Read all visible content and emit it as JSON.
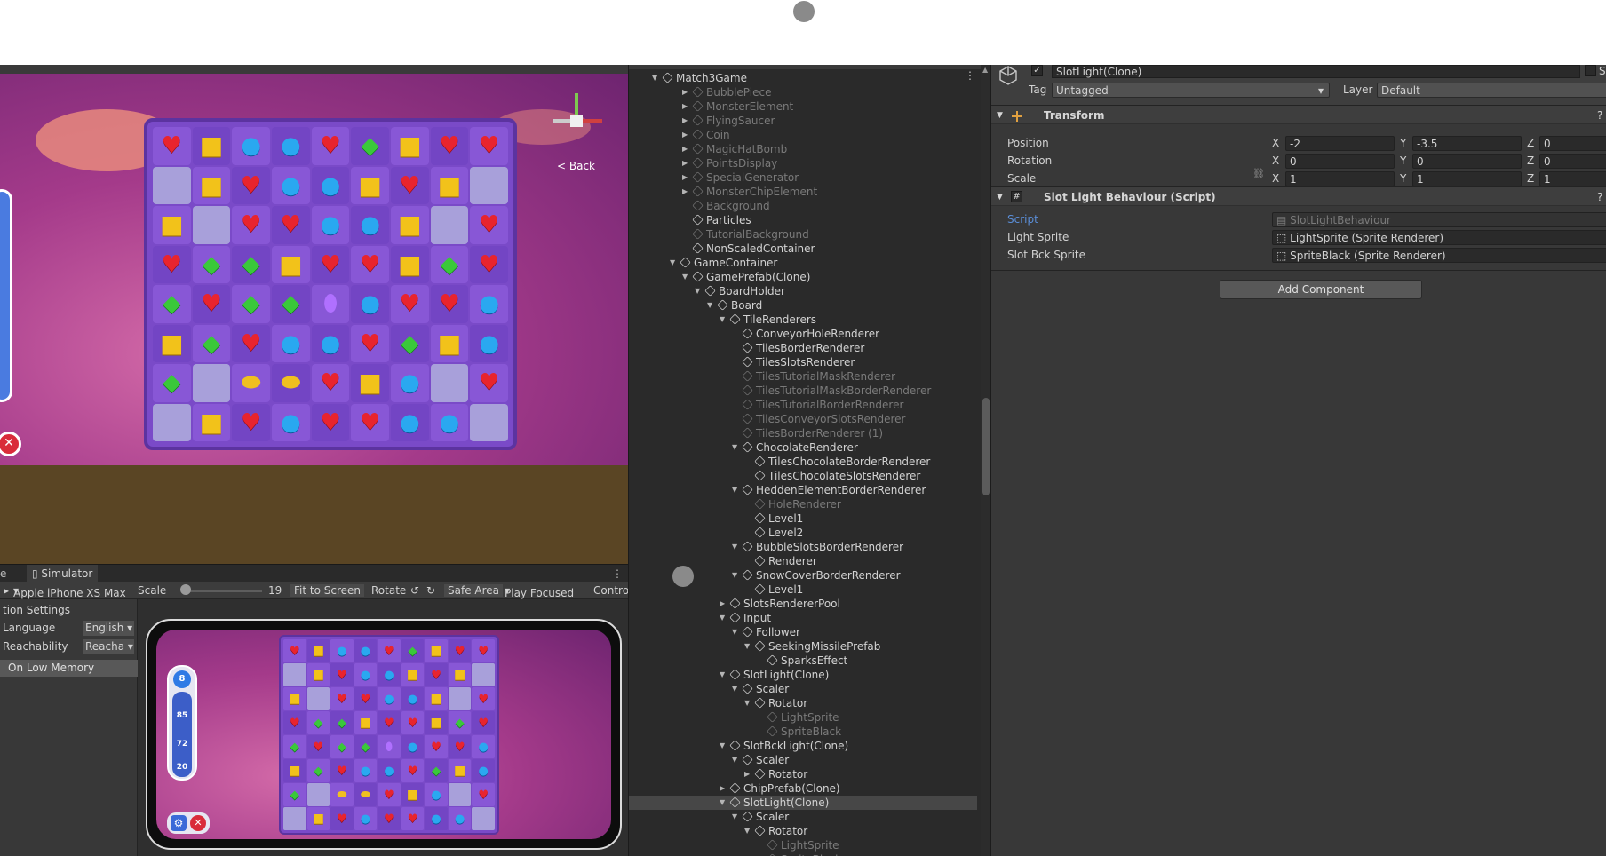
{
  "scene": {
    "back_label": "< Back",
    "board_rows": [
      [
        "heart",
        "square",
        "blue",
        "blue",
        "heart",
        "green",
        "square",
        "heart",
        "heart"
      ],
      [
        "empty",
        "square",
        "heart",
        "blue",
        "blue",
        "square",
        "heart",
        "square",
        "empty"
      ],
      [
        "square",
        "empty",
        "heart",
        "heart",
        "blue",
        "blue",
        "square",
        "empty",
        "heart"
      ],
      [
        "heart",
        "green",
        "green",
        "square",
        "heart",
        "heart",
        "square",
        "green",
        "heart"
      ],
      [
        "green",
        "heart",
        "green",
        "green",
        "jar",
        "blue",
        "heart",
        "heart",
        "blue"
      ],
      [
        "square",
        "green",
        "heart",
        "blue",
        "blue",
        "heart",
        "green",
        "square",
        "blue"
      ],
      [
        "green",
        "empty",
        "bomb",
        "bomb",
        "heart",
        "square",
        "blue",
        "empty",
        "heart"
      ],
      [
        "empty",
        "square",
        "heart",
        "blue",
        "heart",
        "heart",
        "blue",
        "blue",
        "empty"
      ]
    ]
  },
  "simulator": {
    "left_tab_fragment": "e",
    "tab_label": "Simulator",
    "device": "Apple iPhone XS Max",
    "scale_label": "Scale",
    "scale_value": "19",
    "fit_label": "Fit to Screen",
    "rotate_label": "Rotate",
    "safe_area_label": "Safe Area",
    "play_focused_label": "Play Focused",
    "control_label": "Contro",
    "settings_title": "tion Settings",
    "language_label": "Language",
    "language_value": "English",
    "reachability_label": "Reachability",
    "reachability_value": "Reacha",
    "low_memory_label": "On Low Memory",
    "hud": {
      "moves": "8",
      "count1": "85",
      "count2": "72",
      "count3": "20"
    }
  },
  "hierarchy": {
    "rows": [
      {
        "name": "Match3Game",
        "depth": 0,
        "arrow": "down",
        "dim": false,
        "root": true
      },
      {
        "name": "BubblePiece",
        "depth": 3,
        "arrow": "right",
        "dim": true
      },
      {
        "name": "MonsterElement",
        "depth": 3,
        "arrow": "right",
        "dim": true
      },
      {
        "name": "FlyingSaucer",
        "depth": 3,
        "arrow": "right",
        "dim": true
      },
      {
        "name": "Coin",
        "depth": 3,
        "arrow": "right",
        "dim": true
      },
      {
        "name": "MagicHatBomb",
        "depth": 3,
        "arrow": "right",
        "dim": true
      },
      {
        "name": "PointsDisplay",
        "depth": 3,
        "arrow": "right",
        "dim": true
      },
      {
        "name": "SpecialGenerator",
        "depth": 3,
        "arrow": "right",
        "dim": true
      },
      {
        "name": "MonsterChipElement",
        "depth": 3,
        "arrow": "right",
        "dim": true
      },
      {
        "name": "Background",
        "depth": 3,
        "arrow": "",
        "dim": true
      },
      {
        "name": "Particles",
        "depth": 3,
        "arrow": "",
        "dim": false
      },
      {
        "name": "TutorialBackground",
        "depth": 3,
        "arrow": "",
        "dim": true
      },
      {
        "name": "NonScaledContainer",
        "depth": 3,
        "arrow": "",
        "dim": false
      },
      {
        "name": "GameContainer",
        "depth": 2,
        "arrow": "down",
        "dim": false
      },
      {
        "name": "GamePrefab(Clone)",
        "depth": 3,
        "arrow": "down",
        "dim": false
      },
      {
        "name": "BoardHolder",
        "depth": 4,
        "arrow": "down",
        "dim": false
      },
      {
        "name": "Board",
        "depth": 5,
        "arrow": "down",
        "dim": false
      },
      {
        "name": "TileRenderers",
        "depth": 6,
        "arrow": "down",
        "dim": false
      },
      {
        "name": "ConveyorHoleRenderer",
        "depth": 7,
        "arrow": "",
        "dim": false
      },
      {
        "name": "TilesBorderRenderer",
        "depth": 7,
        "arrow": "",
        "dim": false
      },
      {
        "name": "TilesSlotsRenderer",
        "depth": 7,
        "arrow": "",
        "dim": false
      },
      {
        "name": "TilesTutorialMaskRenderer",
        "depth": 7,
        "arrow": "",
        "dim": true
      },
      {
        "name": "TilesTutorialMaskBorderRenderer",
        "depth": 7,
        "arrow": "",
        "dim": true
      },
      {
        "name": "TilesTutorialBorderRenderer",
        "depth": 7,
        "arrow": "",
        "dim": true
      },
      {
        "name": "TilesConveyorSlotsRenderer",
        "depth": 7,
        "arrow": "",
        "dim": true
      },
      {
        "name": "TilesBorderRenderer (1)",
        "depth": 7,
        "arrow": "",
        "dim": true
      },
      {
        "name": "ChocolateRenderer",
        "depth": 7,
        "arrow": "down",
        "dim": false
      },
      {
        "name": "TilesChocolateBorderRenderer",
        "depth": 8,
        "arrow": "",
        "dim": false
      },
      {
        "name": "TilesChocolateSlotsRenderer",
        "depth": 8,
        "arrow": "",
        "dim": false
      },
      {
        "name": "HeddenElementBorderRenderer",
        "depth": 7,
        "arrow": "down",
        "dim": false
      },
      {
        "name": "HoleRenderer",
        "depth": 8,
        "arrow": "",
        "dim": true
      },
      {
        "name": "Level1",
        "depth": 8,
        "arrow": "",
        "dim": false
      },
      {
        "name": "Level2",
        "depth": 8,
        "arrow": "",
        "dim": false
      },
      {
        "name": "BubbleSlotsBorderRenderer",
        "depth": 7,
        "arrow": "down",
        "dim": false
      },
      {
        "name": "Renderer",
        "depth": 8,
        "arrow": "",
        "dim": false
      },
      {
        "name": "SnowCoverBorderRenderer",
        "depth": 7,
        "arrow": "down",
        "dim": false
      },
      {
        "name": "Level1",
        "depth": 8,
        "arrow": "",
        "dim": false
      },
      {
        "name": "SlotsRendererPool",
        "depth": 6,
        "arrow": "right",
        "dim": false
      },
      {
        "name": "Input",
        "depth": 6,
        "arrow": "down",
        "dim": false
      },
      {
        "name": "Follower",
        "depth": 7,
        "arrow": "down",
        "dim": false
      },
      {
        "name": "SeekingMissilePrefab",
        "depth": 8,
        "arrow": "down",
        "dim": false
      },
      {
        "name": "SparksEffect",
        "depth": 9,
        "arrow": "",
        "dim": false
      },
      {
        "name": "SlotLight(Clone)",
        "depth": 6,
        "arrow": "down",
        "dim": false
      },
      {
        "name": "Scaler",
        "depth": 7,
        "arrow": "down",
        "dim": false
      },
      {
        "name": "Rotator",
        "depth": 8,
        "arrow": "down",
        "dim": false
      },
      {
        "name": "LightSprite",
        "depth": 9,
        "arrow": "",
        "dim": true
      },
      {
        "name": "SpriteBlack",
        "depth": 9,
        "arrow": "",
        "dim": true
      },
      {
        "name": "SlotBckLight(Clone)",
        "depth": 6,
        "arrow": "down",
        "dim": false
      },
      {
        "name": "Scaler",
        "depth": 7,
        "arrow": "down",
        "dim": false
      },
      {
        "name": "Rotator",
        "depth": 8,
        "arrow": "right",
        "dim": false
      },
      {
        "name": "ChipPrefab(Clone)",
        "depth": 6,
        "arrow": "right",
        "dim": false
      },
      {
        "name": "SlotLight(Clone)",
        "depth": 6,
        "arrow": "down",
        "dim": false,
        "selected": true
      },
      {
        "name": "Scaler",
        "depth": 7,
        "arrow": "down",
        "dim": false
      },
      {
        "name": "Rotator",
        "depth": 8,
        "arrow": "down",
        "dim": false
      },
      {
        "name": "LightSprite",
        "depth": 9,
        "arrow": "",
        "dim": true
      },
      {
        "name": "SpriteBlack",
        "depth": 9,
        "arrow": "",
        "dim": true
      }
    ]
  },
  "inspector": {
    "object_name": "SlotLight(Clone)",
    "static_fragment": "S",
    "tag_label": "Tag",
    "tag_value": "Untagged",
    "layer_label": "Layer",
    "layer_value": "Default",
    "transform": {
      "title": "Transform",
      "position_label": "Position",
      "rotation_label": "Rotation",
      "scale_label": "Scale",
      "axis_x": "X",
      "axis_y": "Y",
      "axis_z": "Z",
      "position": {
        "x": "-2",
        "y": "-3.5",
        "z": "0"
      },
      "rotation": {
        "x": "0",
        "y": "0",
        "z": "0"
      },
      "scale": {
        "x": "1",
        "y": "1",
        "z": "1"
      }
    },
    "script_component": {
      "title": "Slot Light Behaviour (Script)",
      "script_label": "Script",
      "script_value": "SlotLightBehaviour",
      "light_sprite_label": "Light Sprite",
      "light_sprite_value": "LightSprite (Sprite Renderer)",
      "slot_bck_label": "Slot Bck Sprite",
      "slot_bck_value": "SpriteBlack (Sprite Renderer)"
    },
    "add_component_label": "Add Component"
  },
  "colors": {
    "accent_blue": "#2f7ae5",
    "selection": "#474747"
  }
}
